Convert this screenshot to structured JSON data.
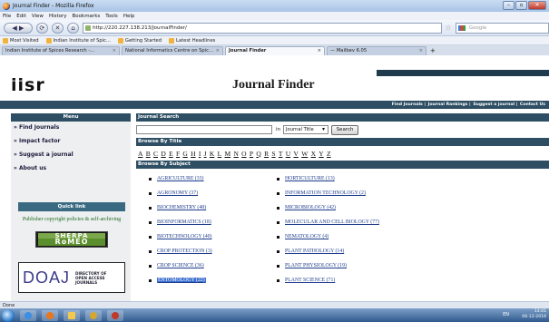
{
  "window": {
    "title": "Journal Finder - Mozilla Firefox"
  },
  "menubar": [
    "File",
    "Edit",
    "View",
    "History",
    "Bookmarks",
    "Tools",
    "Help"
  ],
  "navbar": {
    "url": "http://220.227.138.213/JournalFinder/",
    "search_placeholder": "Google"
  },
  "bookmarks": [
    "Most Visited",
    "Indian Institute of Spic...",
    "Getting Started",
    "Latest Headlines"
  ],
  "tabs": [
    {
      "label": "Indian Institute of Spices Research -...",
      "active": false
    },
    {
      "label": "National Informatics Centre on Spic...",
      "active": false
    },
    {
      "label": "Journal Finder",
      "active": true
    },
    {
      "label": "— Mailbev 6.05",
      "active": false
    }
  ],
  "header": {
    "logo": "iisr",
    "title": "Journal Finder"
  },
  "topnav": [
    "Find Journals",
    "Journal Rankings",
    "Suggest a journal",
    "Contact Us"
  ],
  "sidebar": {
    "menu_title": "Menu",
    "items": [
      "» Find Journals",
      "» Impact factor",
      "» Suggest a journal",
      "» About us"
    ],
    "quick_link": "Quick link",
    "publisher_text": "Publisher copyright policies & self-archiving",
    "romeo_top": "SHERPA",
    "romeo_bottom": "RoMEO",
    "doaj_big": "DOAJ",
    "doaj_small_1": "DIRECTORY OF",
    "doaj_small_2": "OPEN ACCESS",
    "doaj_small_3": "JOURNALS"
  },
  "main": {
    "search_head": "Journal Search",
    "in_label": "in",
    "select_value": "Journal Title",
    "search_button": "Search",
    "browse_title_head": "Browse By Title",
    "letters": [
      "A",
      "B",
      "C",
      "D",
      "E",
      "F",
      "G",
      "H",
      "I",
      "J",
      "K",
      "L",
      "M",
      "N",
      "O",
      "P",
      "Q",
      "R",
      "S",
      "T",
      "U",
      "V",
      "W",
      "X",
      "Y",
      "Z"
    ],
    "browse_subject_head": "Browse By Subject",
    "subjects_left": [
      "AGRICULTURE (33)",
      "AGRONOMY (37)",
      "BIOCHEMISTRY (48)",
      "BIOINFORMATICS (18)",
      "BIOTECHNOLOGY (40)",
      "CROP PROTECTION (3)",
      "CROP SCIENCE (36)",
      "ENTOMOLOGY (22)"
    ],
    "subjects_right": [
      "HORTICULTURE (13)",
      "INFORMATION TECHNOLOGY (2)",
      "MICROBIOLOGY (42)",
      "MOLECULAR AND CELL BIOLOGY (77)",
      "NEMATOLOGY (4)",
      "PLANT PATHOLOGY (14)",
      "PLANT PHYSIOLOGY (19)",
      "PLANT SCIENCE (71)"
    ]
  },
  "statusbar": {
    "text": "Done"
  },
  "taskbar": {
    "lang": "EN",
    "time": "13:41",
    "date": "06-12-2016"
  }
}
